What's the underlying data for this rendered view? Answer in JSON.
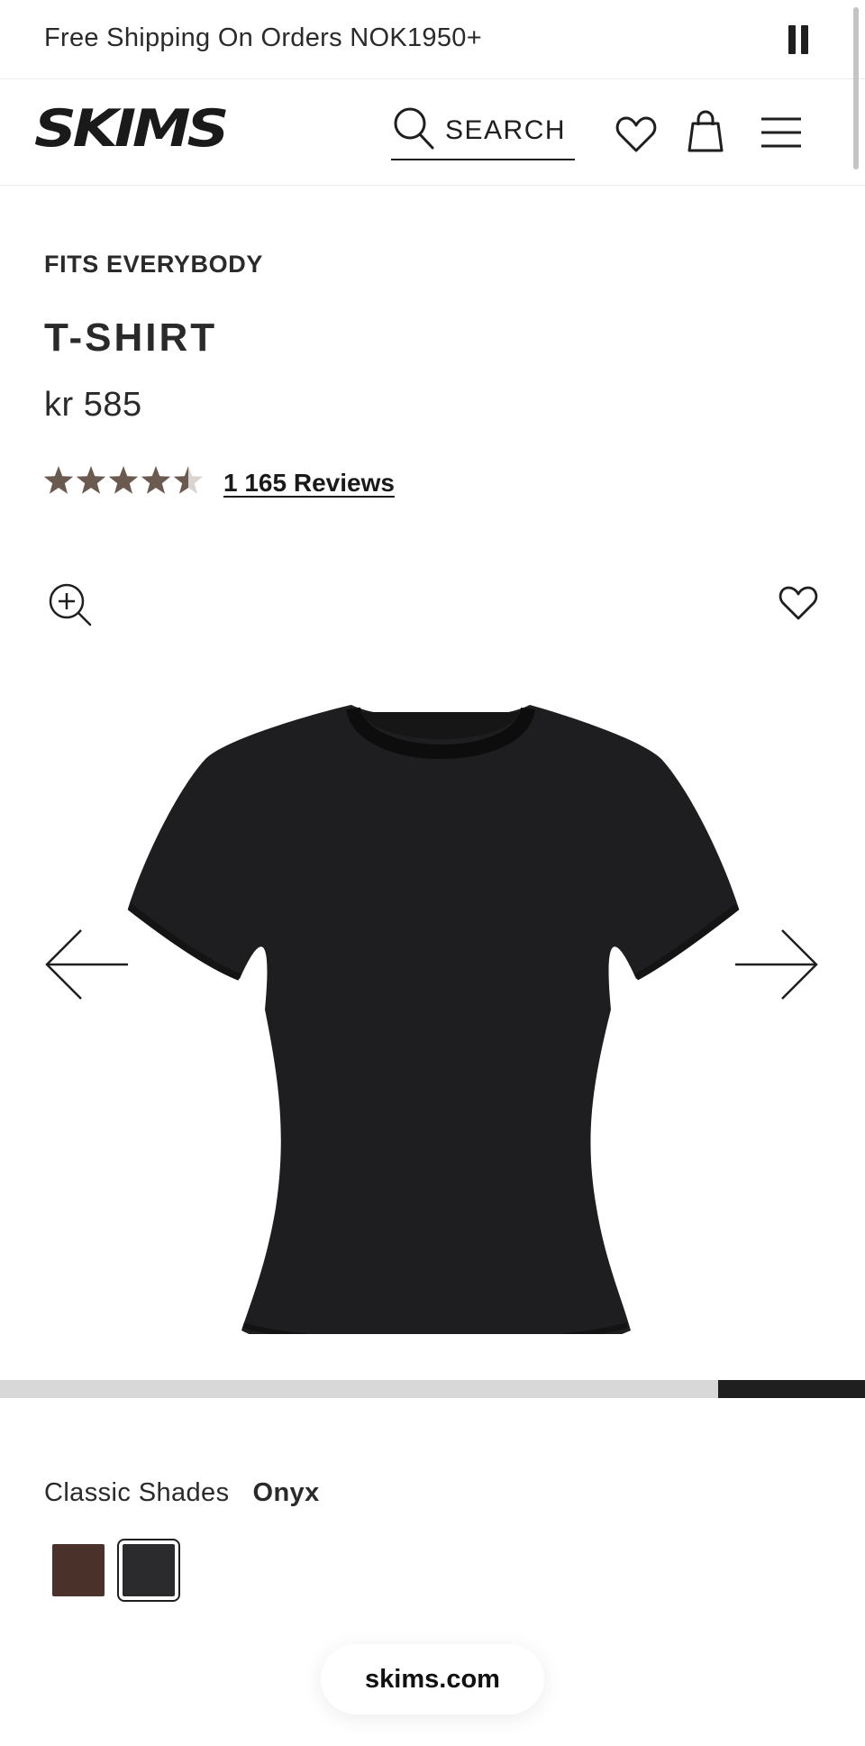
{
  "promo": {
    "text": "Free Shipping On Orders NOK1950+",
    "control": "pause-icon"
  },
  "header": {
    "logo": "SKIMS",
    "search_label": "SEARCH",
    "icons": [
      "search-icon",
      "heart-icon",
      "bag-icon",
      "menu-icon"
    ]
  },
  "product": {
    "brand": "FITS EVERYBODY",
    "title": "T-SHIRT",
    "price": "kr 585",
    "rating": 4.5,
    "rating_max": 5,
    "reviews_label": "1 165 Reviews",
    "star_color": "#6b5a4f"
  },
  "gallery": {
    "icons": [
      "zoom-in-icon",
      "heart-icon",
      "arrow-left-icon",
      "arrow-right-icon"
    ],
    "image": "t-shirt-onyx",
    "progress": 0.83
  },
  "shades": {
    "label": "Classic Shades",
    "selected": "Onyx",
    "swatches": [
      {
        "name": "cocoa",
        "color": "#4a3129",
        "selected": false
      },
      {
        "name": "onyx",
        "color": "#2b2b2e",
        "selected": true
      }
    ]
  },
  "browser": {
    "url": "skims.com"
  }
}
